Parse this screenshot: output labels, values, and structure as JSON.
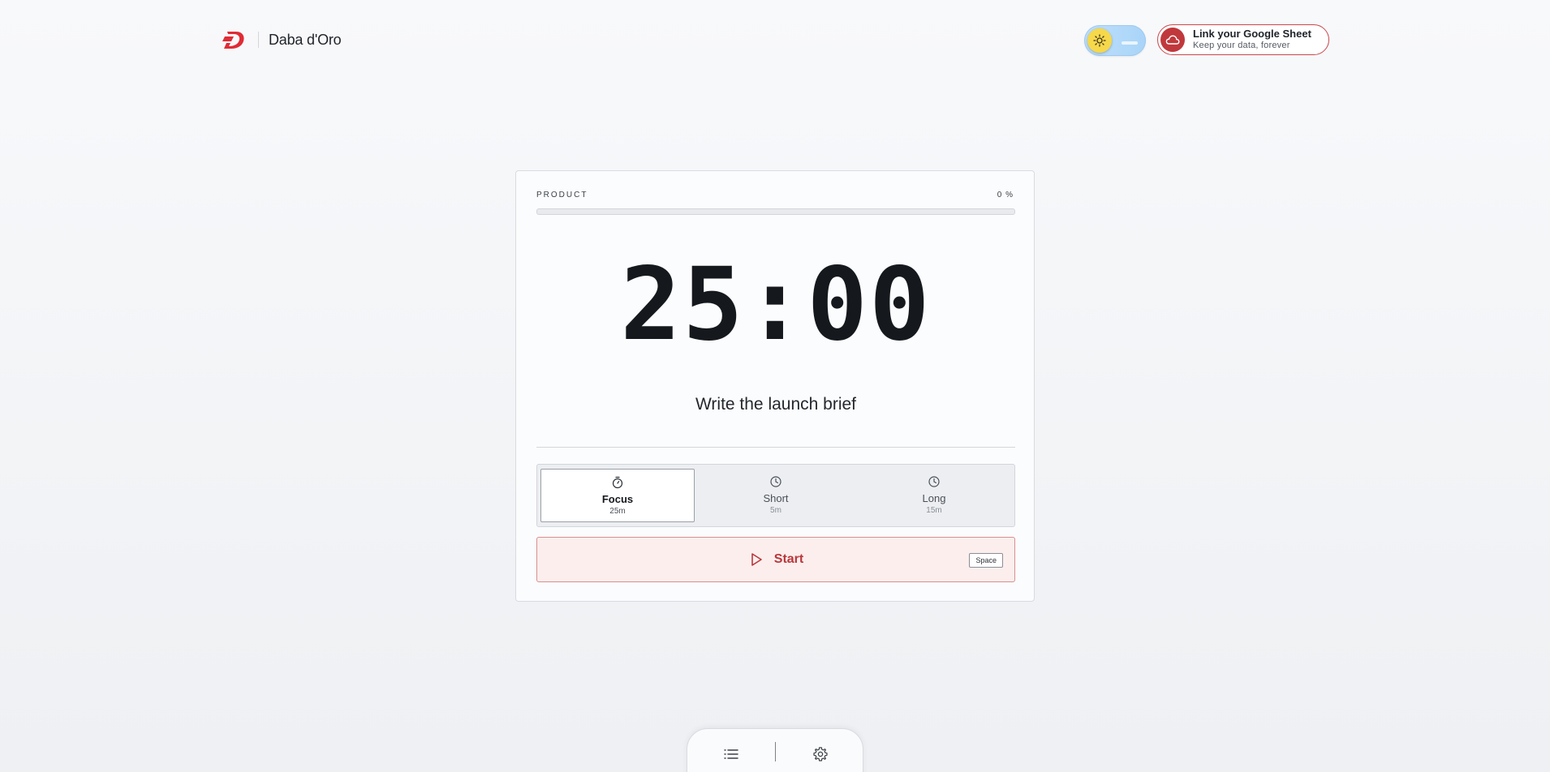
{
  "app": {
    "name": "Daba d'Oro"
  },
  "header": {
    "theme_toggle": {
      "mode": "light",
      "icon": "sun-icon"
    },
    "sheet_link": {
      "title": "Link your Google Sheet",
      "subtitle": "Keep your data, forever",
      "icon": "cloud-icon"
    }
  },
  "timer_card": {
    "progress": {
      "label": "PRODUCT",
      "value_text": "0 %",
      "fraction": 0
    },
    "time": "25:00",
    "task": "Write the launch brief",
    "modes": [
      {
        "label": "Focus",
        "duration": "25m",
        "icon": "stopwatch-icon",
        "active": true
      },
      {
        "label": "Short",
        "duration": "5m",
        "icon": "clock-icon",
        "active": false
      },
      {
        "label": "Long",
        "duration": "15m",
        "icon": "clock-icon",
        "active": false
      }
    ],
    "start": {
      "label": "Start",
      "icon": "play-icon",
      "shortcut": "Space"
    }
  },
  "dock": {
    "items": [
      {
        "icon": "list-icon"
      },
      {
        "icon": "gear-icon"
      }
    ]
  },
  "colors": {
    "accent": "#c0383c",
    "accent_light": "#fbeeed",
    "text": "#15191e"
  }
}
